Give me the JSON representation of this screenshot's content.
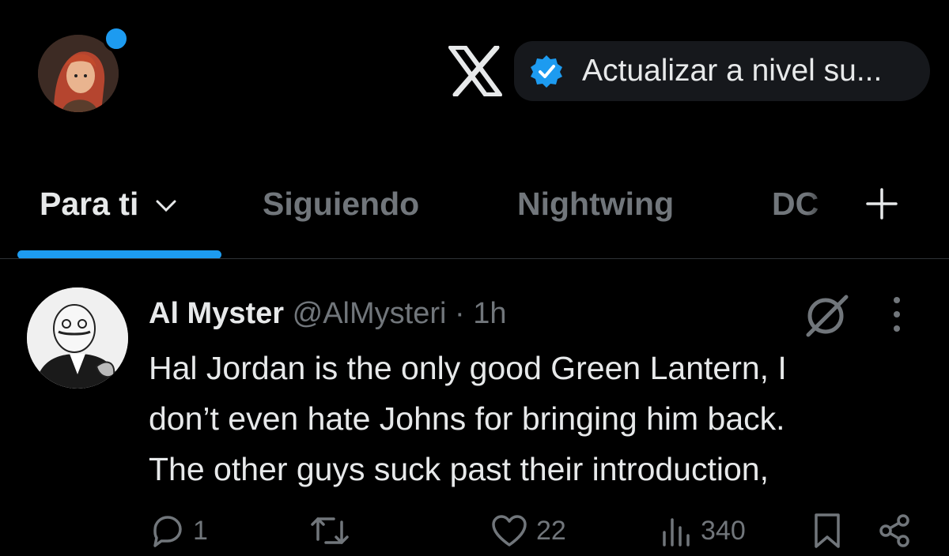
{
  "header": {
    "premium_label": "Actualizar a nivel su..."
  },
  "tabs": [
    {
      "label": "Para ti",
      "active": true
    },
    {
      "label": "Siguiendo",
      "active": false
    },
    {
      "label": "Nightwing",
      "active": false
    },
    {
      "label": "DC",
      "active": false
    }
  ],
  "tweet": {
    "author_name": "Al Myster",
    "handle": "@AlMysteri",
    "separator": "·",
    "time": "1h",
    "lines": [
      "Hal Jordan is the only good Green Lantern, I",
      "don’t even hate Johns for bringing him back.",
      "The other guys suck past their introduction,"
    ],
    "replies": "1",
    "reposts": "",
    "likes": "22",
    "views": "340"
  },
  "colors": {
    "accent": "#1d9bf0",
    "background": "#000000",
    "muted": "#71767b",
    "text": "#e7e9ea"
  },
  "icons": [
    "x-logo-icon",
    "verified-icon",
    "chevron-down-icon",
    "plus-icon",
    "grok-icon",
    "more-icon",
    "reply-icon",
    "repost-icon",
    "like-icon",
    "views-icon",
    "bookmark-icon",
    "share-icon"
  ]
}
